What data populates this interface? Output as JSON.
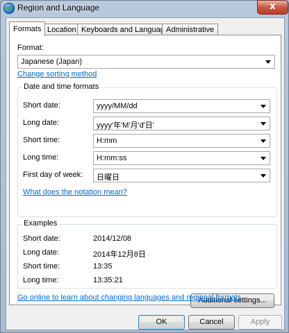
{
  "window": {
    "title": "Region and Language",
    "close_label": "x"
  },
  "tabs": [
    {
      "label": "Formats"
    },
    {
      "label": "Location"
    },
    {
      "label": "Keyboards and Languages"
    },
    {
      "label": "Administrative"
    }
  ],
  "formats": {
    "format_label": "Format:",
    "format_value": "Japanese (Japan)",
    "sorting_link": "Change sorting method",
    "datetime_group_title": "Date and time formats",
    "fields": [
      {
        "label": "Short date:",
        "value": "yyyy/MM/dd"
      },
      {
        "label": "Long date:",
        "value": "yyyy'年'M'月'd'日'"
      },
      {
        "label": "Short time:",
        "value": "H:mm"
      },
      {
        "label": "Long time:",
        "value": "H:mm:ss"
      },
      {
        "label": "First day of week:",
        "value": "日曜日"
      }
    ],
    "notation_link": "What does the notation mean?",
    "examples_title": "Examples",
    "examples": [
      {
        "label": "Short date:",
        "value": "2014/12/08"
      },
      {
        "label": "Long date:",
        "value": "2014年12月8日"
      },
      {
        "label": "Short time:",
        "value": "13:35"
      },
      {
        "label": "Long time:",
        "value": "13:35:21"
      }
    ],
    "additional_settings": "Additional settings...",
    "online_link": "Go online to learn about changing languages and regional formats"
  },
  "footer": {
    "ok": "OK",
    "cancel": "Cancel",
    "apply": "Apply"
  }
}
